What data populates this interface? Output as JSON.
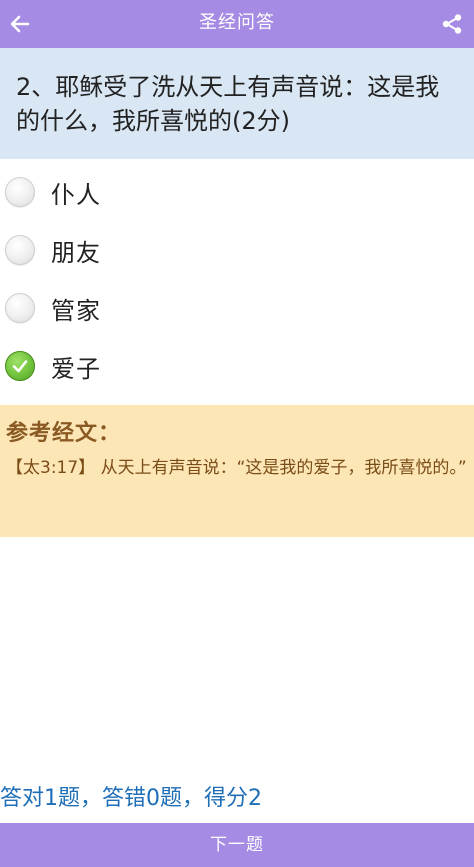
{
  "header": {
    "title": "圣经问答",
    "back_icon": "arrow-left-icon",
    "share_icon": "share-icon",
    "color": "#a58be3"
  },
  "question": {
    "text": "2、耶稣受了洗从天上有声音说：这是我的什么，我所喜悦的(2分)",
    "background": "#d9e6f3"
  },
  "options": [
    {
      "label": "仆人",
      "selected": false
    },
    {
      "label": "朋友",
      "selected": false
    },
    {
      "label": "管家",
      "selected": false
    },
    {
      "label": "爱子",
      "selected": true
    }
  ],
  "reference": {
    "heading": "参考经文：",
    "text": "【太3:17】 从天上有声音说：“这是我的爱子，我所喜悦的。”",
    "background": "#fce6b6"
  },
  "score": {
    "text": "答对1题，答错0题，得分2",
    "color": "#1f6fb8"
  },
  "footer": {
    "next_label": "下一题"
  }
}
